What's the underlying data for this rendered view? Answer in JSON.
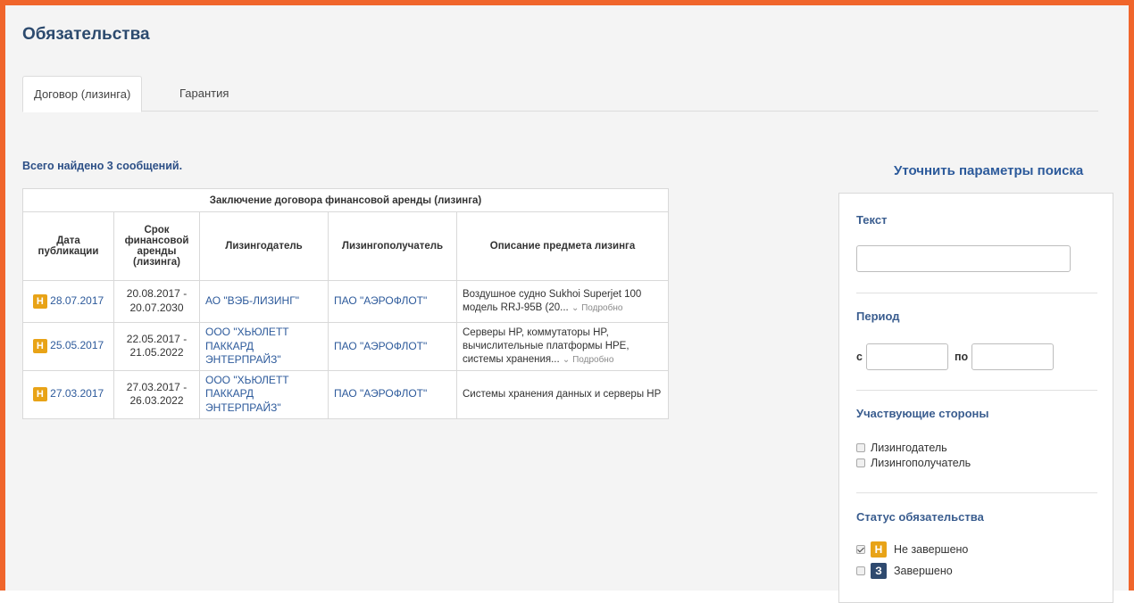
{
  "page": {
    "title": "Обязательства"
  },
  "tabs": [
    {
      "label": "Договор (лизинга)",
      "active": true
    },
    {
      "label": "Гарантия",
      "active": false
    }
  ],
  "results": {
    "found_text": "Всего найдено 3 сообщений."
  },
  "table": {
    "caption": "Заключение договора финансовой аренды (лизинга)",
    "headers": [
      "Дата публикации",
      "Срок финансовой аренды (лизинга)",
      "Лизингодатель",
      "Лизингополучатель",
      "Описание предмета лизинга"
    ],
    "more_label": "Подробно",
    "rows": [
      {
        "badge": "Н",
        "date": "28.07.2017",
        "term": "20.08.2017 - 20.07.2030",
        "lessor": "АО \"ВЭБ-ЛИЗИНГ\"",
        "lessee": "ПАО \"АЭРОФЛОТ\"",
        "description": "Воздушное судно Sukhoi Superjet 100 модель RRJ-95B (20...",
        "has_more": true
      },
      {
        "badge": "Н",
        "date": "25.05.2017",
        "term": "22.05.2017 - 21.05.2022",
        "lessor": "ООО \"ХЬЮЛЕТТ ПАККАРД ЭНТЕРПРАЙЗ\"",
        "lessee": "ПАО \"АЭРОФЛОТ\"",
        "description": "Серверы HP, коммутаторы HP, вычислительные платформы HPE, системы хранения...",
        "has_more": true
      },
      {
        "badge": "Н",
        "date": "27.03.2017",
        "term": "27.03.2017 - 26.03.2022",
        "lessor": "ООО \"ХЬЮЛЕТТ ПАККАРД ЭНТЕРПРАЙЗ\"",
        "lessee": "ПАО \"АЭРОФЛОТ\"",
        "description": "Системы хранения данных и серверы HP",
        "has_more": false
      }
    ]
  },
  "filters": {
    "title": "Уточнить параметры поиска",
    "text_label": "Текст",
    "text_value": "",
    "period_label": "Период",
    "period_from_label": "с",
    "period_to_label": "по",
    "period_from": "",
    "period_to": "",
    "parties_label": "Участвующие стороны",
    "parties": [
      {
        "label": "Лизингодатель",
        "checked": false
      },
      {
        "label": "Лизингополучатель",
        "checked": false
      }
    ],
    "status_label": "Статус обязательства",
    "statuses": [
      {
        "badge": "Н",
        "label": "Не завершено",
        "checked": true
      },
      {
        "badge": "З",
        "label": "Завершено",
        "checked": false
      }
    ]
  },
  "colors": {
    "frame": "#f0652b",
    "badge_open": "#e8a317",
    "badge_closed": "#2f4a6f",
    "link": "#2d5a9b"
  }
}
